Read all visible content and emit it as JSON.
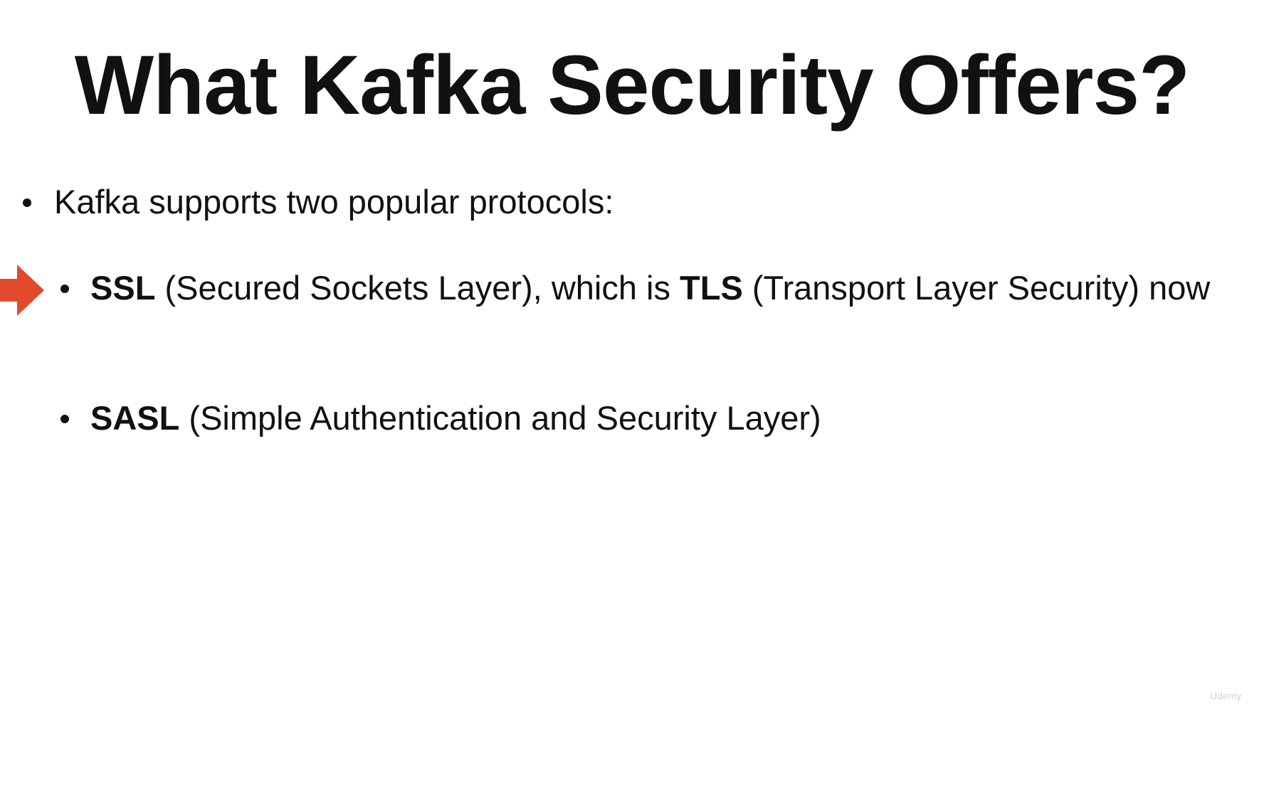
{
  "slide": {
    "title": "What Kafka Security Offers?",
    "bullets": [
      {
        "text": "Kafka supports two popular protocols:"
      },
      {
        "term1": "SSL",
        "desc1": " (Secured Sockets Layer), which is ",
        "term2": "TLS",
        "desc2": " (Transport Layer Security) now"
      },
      {
        "term": "SASL",
        "desc": " (Simple Authentication and Security Layer)"
      }
    ],
    "pointer": {
      "icon": "right-arrow-icon",
      "color": "#e24a2e"
    },
    "watermark": "Udemy"
  }
}
